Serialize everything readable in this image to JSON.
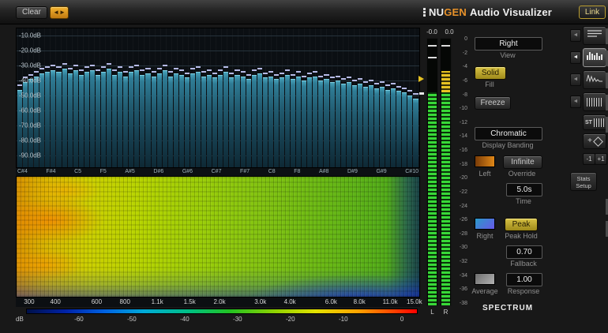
{
  "topbar": {
    "clear_label": "Clear",
    "arrows_glyph": "◄►",
    "brand_nu": "NU",
    "brand_gen": "GEN",
    "brand_suffix": "Audio Visualizer",
    "link_label": "Link"
  },
  "spectrum": {
    "db_axis_labels": [
      "-10.0dB",
      "-20.0dB",
      "-30.0dB",
      "-40.0dB",
      "-50.0dB",
      "-60.0dB",
      "-70.0dB",
      "-80.0dB",
      "-90.0dB"
    ],
    "note_labels": [
      "C#4",
      "F#4",
      "C5",
      "F5",
      "A#5",
      "D#6",
      "G#6",
      "C#7",
      "F#7",
      "C8",
      "F8",
      "A#8",
      "D#9",
      "G#9",
      "C#10"
    ],
    "ylim": [
      -98,
      -5
    ],
    "peak_offset_db": 2.5,
    "bars_db": [
      -46,
      -41,
      -39,
      -37,
      -35,
      -34,
      -33,
      -34,
      -32,
      -35,
      -33,
      -36,
      -34,
      -33,
      -36,
      -34,
      -32,
      -36,
      -34,
      -37,
      -34,
      -33,
      -36,
      -35,
      -37,
      -35,
      -33,
      -37,
      -35,
      -36,
      -38,
      -35,
      -34,
      -37,
      -36,
      -38,
      -36,
      -34,
      -38,
      -36,
      -37,
      -39,
      -36,
      -35,
      -38,
      -37,
      -39,
      -38,
      -36,
      -39,
      -37,
      -40,
      -38,
      -37,
      -40,
      -39,
      -41,
      -40,
      -42,
      -41,
      -43,
      -42,
      -44,
      -43,
      -45,
      -44,
      -46,
      -45,
      -47,
      -48,
      -50,
      -52
    ]
  },
  "spectrogram": {
    "freq_labels": [
      {
        "text": "300",
        "pct": 3.3
      },
      {
        "text": "400",
        "pct": 9.8
      },
      {
        "text": "600",
        "pct": 20
      },
      {
        "text": "800",
        "pct": 27
      },
      {
        "text": "1.1k",
        "pct": 35
      },
      {
        "text": "1.5k",
        "pct": 43
      },
      {
        "text": "2.0k",
        "pct": 50.4
      },
      {
        "text": "3.0k",
        "pct": 60.5
      },
      {
        "text": "4.0k",
        "pct": 67.8
      },
      {
        "text": "6.0k",
        "pct": 78
      },
      {
        "text": "8.0k",
        "pct": 85
      },
      {
        "text": "11.0k",
        "pct": 92.6
      },
      {
        "text": "15.0k",
        "pct": 98.6
      }
    ]
  },
  "color_scale": {
    "unit": "dB",
    "labels": [
      {
        "text": "-60",
        "pct": 13.5
      },
      {
        "text": "-50",
        "pct": 27
      },
      {
        "text": "-40",
        "pct": 40.5
      },
      {
        "text": "-30",
        "pct": 54
      },
      {
        "text": "-20",
        "pct": 67.5
      },
      {
        "text": "-10",
        "pct": 81
      },
      {
        "text": "0",
        "pct": 96
      }
    ]
  },
  "meters": {
    "readout_left": "-0.0",
    "readout_right": "0.0",
    "scale": [
      "0",
      "-2",
      "-4",
      "-6",
      "-8",
      "-10",
      "-12",
      "-14",
      "-16",
      "-18",
      "-20",
      "-22",
      "-24",
      "-26",
      "-28",
      "-30",
      "-32",
      "-34",
      "-36",
      "-38"
    ],
    "label_left": "L",
    "label_right": "R"
  },
  "controls": {
    "view": {
      "value": "Right",
      "label": "View"
    },
    "fill": {
      "value": "Solid",
      "label": "Fill"
    },
    "freeze_label": "Freeze",
    "banding": {
      "value": "Chromatic",
      "label": "Display Banding"
    },
    "left_label": "Left",
    "override": {
      "value": "Infinite",
      "label": "Override"
    },
    "time": {
      "value": "5.0s",
      "label": "Time"
    },
    "right_label": "Right",
    "peak_hold": {
      "value": "Peak",
      "label": "Peak Hold"
    },
    "fallback": {
      "value": "0.70",
      "label": "Fallback"
    },
    "average_label": "Average",
    "response": {
      "value": "1.00",
      "label": "Response"
    },
    "footer": "SPECTRUM"
  },
  "sidebar": {
    "arrow_glyph": "◄",
    "st_label": "ST",
    "plus_glyph": "+",
    "nudge_minus": "-1",
    "nudge_plus": "+1",
    "stats_line1": "Stats",
    "stats_line2": "Setup"
  },
  "colors": {
    "accent_yellow": "#d4b428",
    "accent_orange": "#e8922a",
    "bar_teal": "#2a7a92",
    "meter_green": "#35d435"
  }
}
